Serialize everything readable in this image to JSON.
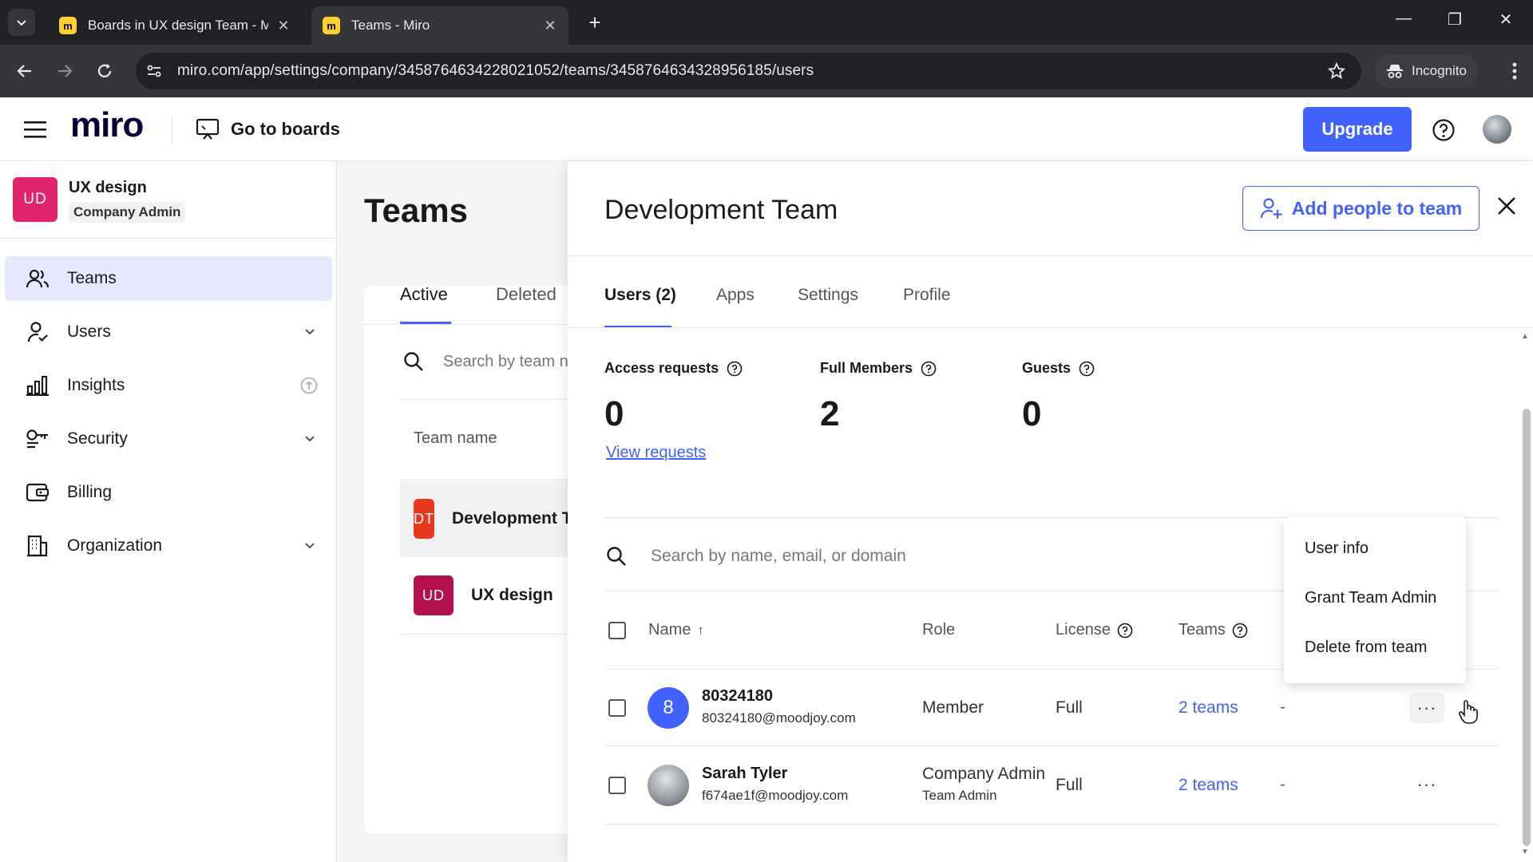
{
  "browser": {
    "tabs": [
      {
        "title": "Boards in UX design Team - Miro",
        "favicon_letter": "m"
      },
      {
        "title": "Teams - Miro",
        "favicon_letter": "m"
      }
    ],
    "url": "miro.com/app/settings/company/3458764634228021052/teams/3458764634328956185/users",
    "incognito_label": "Incognito"
  },
  "header": {
    "logo": "miro",
    "goto_boards": "Go to boards",
    "upgrade": "Upgrade"
  },
  "sidebar": {
    "org": {
      "badge": "UD",
      "name": "UX design",
      "role": "Company Admin",
      "badge_color": "#e0256c"
    },
    "items": [
      {
        "label": "Teams",
        "icon": "teams-icon",
        "active": true
      },
      {
        "label": "Users",
        "icon": "users-icon",
        "has_chevron": true
      },
      {
        "label": "Insights",
        "icon": "insights-icon",
        "has_info": true
      },
      {
        "label": "Security",
        "icon": "security-icon",
        "has_chevron": true
      },
      {
        "label": "Billing",
        "icon": "billing-icon"
      },
      {
        "label": "Organization",
        "icon": "organization-icon",
        "has_chevron": true
      }
    ]
  },
  "teams_page": {
    "title": "Teams",
    "tabs": [
      "Active",
      "Deleted"
    ],
    "search_placeholder": "Search by team name",
    "column_team_name": "Team name",
    "teams": [
      {
        "badge": "DT",
        "name": "Development Team",
        "color": "#e8381f",
        "selected": true
      },
      {
        "badge": "UD",
        "name": "UX design",
        "color": "#b3104e"
      }
    ]
  },
  "drawer": {
    "title": "Development Team",
    "add_people": "Add people to team",
    "tabs": [
      "Users (2)",
      "Apps",
      "Settings",
      "Profile"
    ],
    "stats": [
      {
        "label": "Access requests",
        "value": "0"
      },
      {
        "label": "Full Members",
        "value": "2"
      },
      {
        "label": "Guests",
        "value": "0"
      }
    ],
    "view_requests": "View requests",
    "search_placeholder": "Search by name, email, or domain",
    "columns": {
      "name": "Name",
      "sort_arrow": "↑",
      "role": "Role",
      "license": "License",
      "teams": "Teams"
    },
    "users": [
      {
        "avatar_text": "8",
        "avatar_color": "#4262ff",
        "name": "80324180",
        "email": "80324180@moodjoy.com",
        "role": "Member",
        "role2": "",
        "license": "Full",
        "teams": "2 teams",
        "extra": "-"
      },
      {
        "avatar_text": "",
        "avatar_color": "#8a9097",
        "name": "Sarah Tyler",
        "email": "f674ae1f@moodjoy.com",
        "role": "Company Admin",
        "role2": "Team Admin",
        "license": "Full",
        "teams": "2 teams",
        "extra": "-"
      }
    ],
    "more_label": "···"
  },
  "context_menu": {
    "items": [
      "User info",
      "Grant Team Admin",
      "Delete from team"
    ]
  },
  "colors": {
    "accent": "#4262ff",
    "active_nav_bg": "#e6e8ff"
  }
}
